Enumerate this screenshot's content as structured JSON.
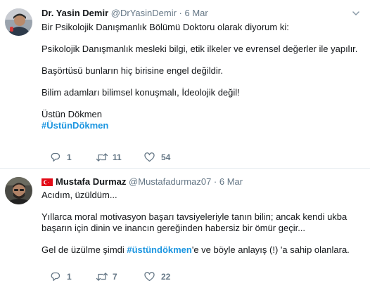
{
  "tweets": [
    {
      "name": "Dr. Yasin Demir",
      "handle": "@DrYasinDemir",
      "separator": "·",
      "date": "6 Mar",
      "lines": [
        "Bir Psikolojik Danışmanlık Bölümü Doktoru olarak diyorum ki:",
        "Psikolojik Danışmanlık mesleki bilgi, etik ilkeler ve evrensel değerler ile yapılır.",
        "Başörtüsü bunların hiç birisine engel değildir.",
        "Bilim adamları bilimsel konuşmalı, İdeolojik değil!",
        "Üstün Dökmen"
      ],
      "hashtag": "#ÜstünDökmen",
      "replies": "1",
      "retweets": "11",
      "likes": "54"
    },
    {
      "name": "Mustafa Durmaz",
      "handle": "@Mustafadurmaz07",
      "separator": "·",
      "date": "6 Mar",
      "line1": "Acıdım, üzüldüm...",
      "line2": "Yıllarca moral motivasyon başarı tavsiyeleriyle tanın bilin; ancak kendi ukba başarın için dinin ve inancın gereğinden habersiz bir ömür geçir...",
      "line3_before": "Gel de üzülme şimdi ",
      "line3_hashtag": "#üstündökmen",
      "line3_after": "'e ve böyle anlayış (!) 'a sahip olanlara.",
      "replies": "1",
      "retweets": "7",
      "likes": "22"
    }
  ],
  "colors": {
    "hashtag": "#1b95e0",
    "secondary_text": "#657786",
    "divider": "#e6ecf0"
  },
  "icons": [
    "reply-icon",
    "retweet-icon",
    "like-icon",
    "chevron-down-icon",
    "turkey-flag-icon"
  ]
}
